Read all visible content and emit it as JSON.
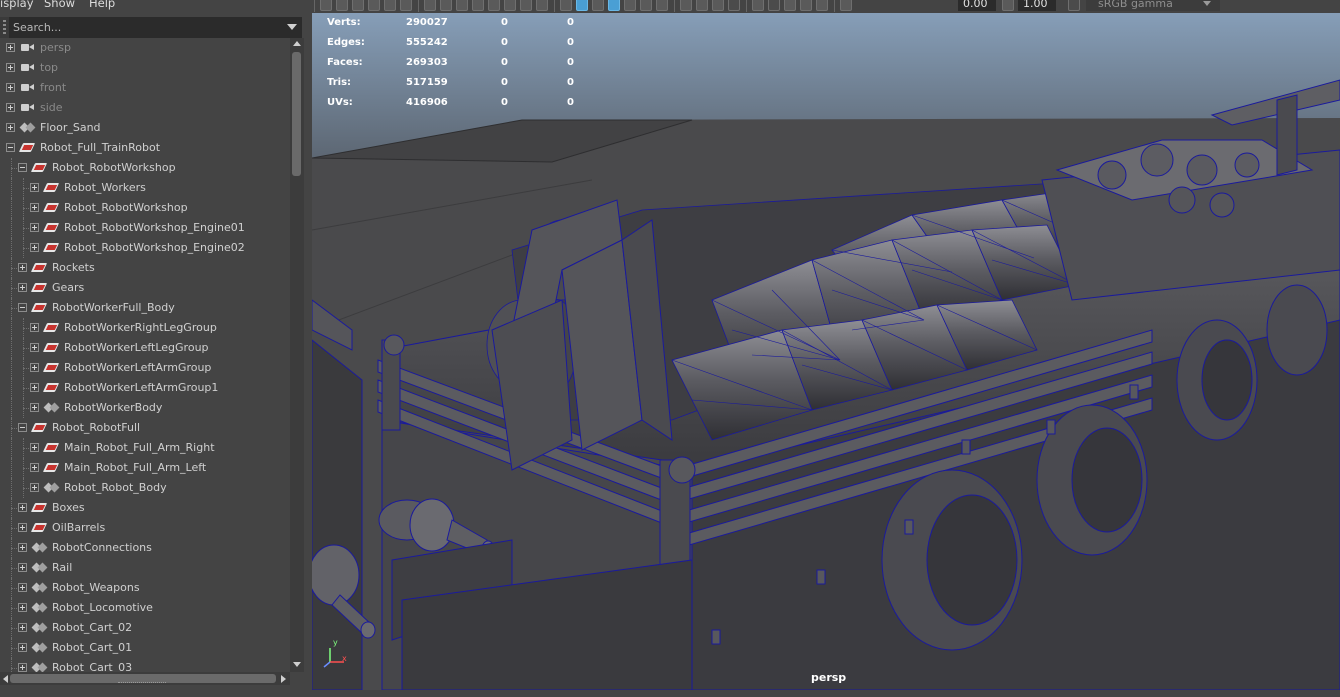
{
  "menu": {
    "display_label": "isplay",
    "show_label": "Show",
    "help_label": "Help"
  },
  "search": {
    "placeholder": "Search..."
  },
  "outliner": {
    "items": [
      {
        "label": "persp",
        "icon": "camera-icon",
        "depth": 0,
        "expander": "plus"
      },
      {
        "label": "top",
        "icon": "camera-icon",
        "depth": 0,
        "expander": "plus"
      },
      {
        "label": "front",
        "icon": "camera-icon",
        "depth": 0,
        "expander": "plus"
      },
      {
        "label": "side",
        "icon": "camera-icon",
        "depth": 0,
        "expander": "plus"
      },
      {
        "label": "Floor_Sand",
        "icon": "transform-icon",
        "depth": 0,
        "expander": "plus"
      },
      {
        "label": "Robot_Full_TrainRobot",
        "icon": "group-icon",
        "depth": 0,
        "expander": "minus"
      },
      {
        "label": "Robot_RobotWorkshop",
        "icon": "group-icon",
        "depth": 1,
        "expander": "minus"
      },
      {
        "label": "Robot_Workers",
        "icon": "group-icon",
        "depth": 2,
        "expander": "plus"
      },
      {
        "label": "Robot_RobotWorkshop",
        "icon": "group-icon",
        "depth": 2,
        "expander": "plus"
      },
      {
        "label": "Robot_RobotWorkshop_Engine01",
        "icon": "group-icon",
        "depth": 2,
        "expander": "plus"
      },
      {
        "label": "Robot_RobotWorkshop_Engine02",
        "icon": "group-icon",
        "depth": 2,
        "expander": "plus"
      },
      {
        "label": "Rockets",
        "icon": "group-icon",
        "depth": 1,
        "expander": "plus"
      },
      {
        "label": "Gears",
        "icon": "group-icon",
        "depth": 1,
        "expander": "plus"
      },
      {
        "label": "RobotWorkerFull_Body",
        "icon": "group-icon",
        "depth": 1,
        "expander": "minus"
      },
      {
        "label": "RobotWorkerRightLegGroup",
        "icon": "group-icon",
        "depth": 2,
        "expander": "plus"
      },
      {
        "label": "RobotWorkerLeftLegGroup",
        "icon": "group-icon",
        "depth": 2,
        "expander": "plus"
      },
      {
        "label": "RobotWorkerLeftArmGroup",
        "icon": "group-icon",
        "depth": 2,
        "expander": "plus"
      },
      {
        "label": "RobotWorkerLeftArmGroup1",
        "icon": "group-icon",
        "depth": 2,
        "expander": "plus"
      },
      {
        "label": "RobotWorkerBody",
        "icon": "transform-icon",
        "depth": 2,
        "expander": "plus"
      },
      {
        "label": "Robot_RobotFull",
        "icon": "group-icon",
        "depth": 1,
        "expander": "minus"
      },
      {
        "label": "Main_Robot_Full_Arm_Right",
        "icon": "group-icon",
        "depth": 2,
        "expander": "plus"
      },
      {
        "label": "Main_Robot_Full_Arm_Left",
        "icon": "group-icon",
        "depth": 2,
        "expander": "plus"
      },
      {
        "label": "Robot_Robot_Body",
        "icon": "transform-icon",
        "depth": 2,
        "expander": "plus"
      },
      {
        "label": "Boxes",
        "icon": "group-icon",
        "depth": 1,
        "expander": "plus"
      },
      {
        "label": "OilBarrels",
        "icon": "group-icon",
        "depth": 1,
        "expander": "plus"
      },
      {
        "label": "RobotConnections",
        "icon": "transform-icon",
        "depth": 1,
        "expander": "plus"
      },
      {
        "label": "Rail",
        "icon": "transform-icon",
        "depth": 1,
        "expander": "plus"
      },
      {
        "label": "Robot_Weapons",
        "icon": "transform-icon",
        "depth": 1,
        "expander": "plus"
      },
      {
        "label": "Robot_Locomotive",
        "icon": "transform-icon",
        "depth": 1,
        "expander": "plus"
      },
      {
        "label": "Robot_Cart_02",
        "icon": "transform-icon",
        "depth": 1,
        "expander": "plus"
      },
      {
        "label": "Robot_Cart_01",
        "icon": "transform-icon",
        "depth": 1,
        "expander": "plus"
      },
      {
        "label": "Robot_Cart_03",
        "icon": "transform-icon",
        "depth": 1,
        "expander": "plus"
      }
    ]
  },
  "toolbar": {
    "exposure_value": "0.00",
    "gamma_value": "1.00",
    "color_space": "sRGB gamma"
  },
  "hud": {
    "rows": [
      {
        "label": "Verts:",
        "total": "290027",
        "selected": "0",
        "component": "0"
      },
      {
        "label": "Edges:",
        "total": "555242",
        "selected": "0",
        "component": "0"
      },
      {
        "label": "Faces:",
        "total": "269303",
        "selected": "0",
        "component": "0"
      },
      {
        "label": "Tris:",
        "total": "517159",
        "selected": "0",
        "component": "0"
      },
      {
        "label": "UVs:",
        "total": "416906",
        "selected": "0",
        "component": "0"
      }
    ]
  },
  "viewport": {
    "camera_name": "persp",
    "axis_x": "x",
    "axis_y": "y"
  },
  "colors": {
    "wireframe": "#1a1a9c",
    "sky_top": "#8ba4bf",
    "sky_bottom": "#5a6470",
    "ground": "#4b4b4d",
    "selection_accent": "#4a9fd4"
  }
}
